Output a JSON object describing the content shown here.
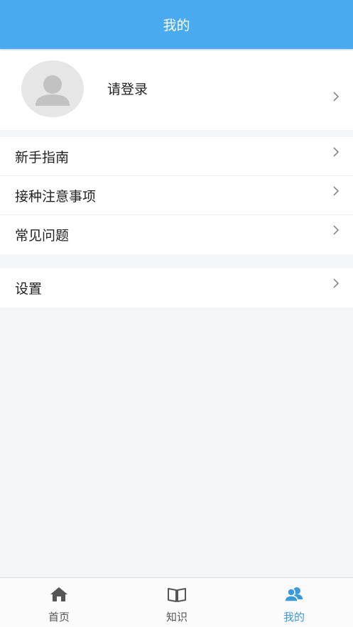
{
  "header": {
    "title": "我的"
  },
  "profile": {
    "login_prompt": "请登录"
  },
  "menu_groups": [
    {
      "items": [
        {
          "label": "新手指南"
        },
        {
          "label": "接种注意事项"
        },
        {
          "label": "常见问题"
        }
      ]
    },
    {
      "items": [
        {
          "label": "设置"
        }
      ]
    }
  ],
  "tabs": [
    {
      "label": "首页",
      "icon": "home-icon",
      "active": false
    },
    {
      "label": "知识",
      "icon": "book-icon",
      "active": false
    },
    {
      "label": "我的",
      "icon": "users-icon",
      "active": true
    }
  ],
  "colors": {
    "accent": "#4aaaf0",
    "tab_active": "#3a9ad9",
    "background": "#f4f5f7"
  }
}
